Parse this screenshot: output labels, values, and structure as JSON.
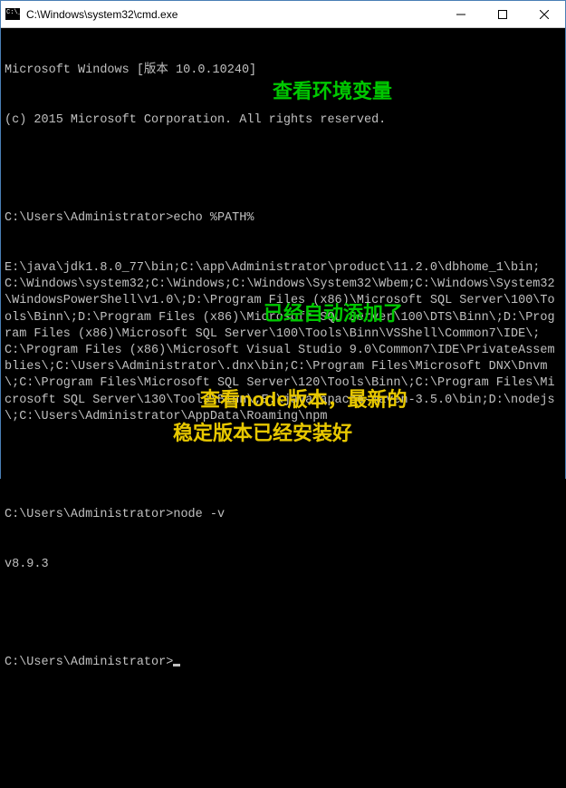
{
  "window": {
    "title": "C:\\Windows\\system32\\cmd.exe"
  },
  "terminal": {
    "header1": "Microsoft Windows [版本 10.0.10240]",
    "header2": "(c) 2015 Microsoft Corporation. All rights reserved.",
    "prompt1": "C:\\Users\\Administrator>",
    "cmd1": "echo %PATH%",
    "path_output": "E:\\java\\jdk1.8.0_77\\bin;C:\\app\\Administrator\\product\\11.2.0\\dbhome_1\\bin;C:\\Windows\\system32;C:\\Windows;C:\\Windows\\System32\\Wbem;C:\\Windows\\System32\\WindowsPowerShell\\v1.0\\;D:\\Program Files (x86)\\Microsoft SQL Server\\100\\Tools\\Binn\\;D:\\Program Files (x86)\\Microsoft SQL Server\\100\\DTS\\Binn\\;D:\\Program Files (x86)\\Microsoft SQL Server\\100\\Tools\\Binn\\VSShell\\Common7\\IDE\\;C:\\Program Files (x86)\\Microsoft Visual Studio 9.0\\Common7\\IDE\\PrivateAssemblies\\;C:\\Users\\Administrator\\.dnx\\bin;C:\\Program Files\\Microsoft DNX\\Dnvm\\;C:\\Program Files\\Microsoft SQL Server\\120\\Tools\\Binn\\;C:\\Program Files\\Microsoft SQL Server\\130\\Tools\\Binn\\;E:\\java\\apache-maven-3.5.0\\bin;D:\\nodejs\\;C:\\Users\\Administrator\\AppData\\Roaming\\npm",
    "prompt2": "C:\\Users\\Administrator>",
    "cmd2": "node -v",
    "node_out": "v8.9.3",
    "prompt3": "C:\\Users\\Administrator>"
  },
  "annotations": {
    "a1": "查看环境变量",
    "a2": "已经自动添加了",
    "a3": "查看node版本，最新的",
    "a4": "稳定版本已经安装好"
  }
}
